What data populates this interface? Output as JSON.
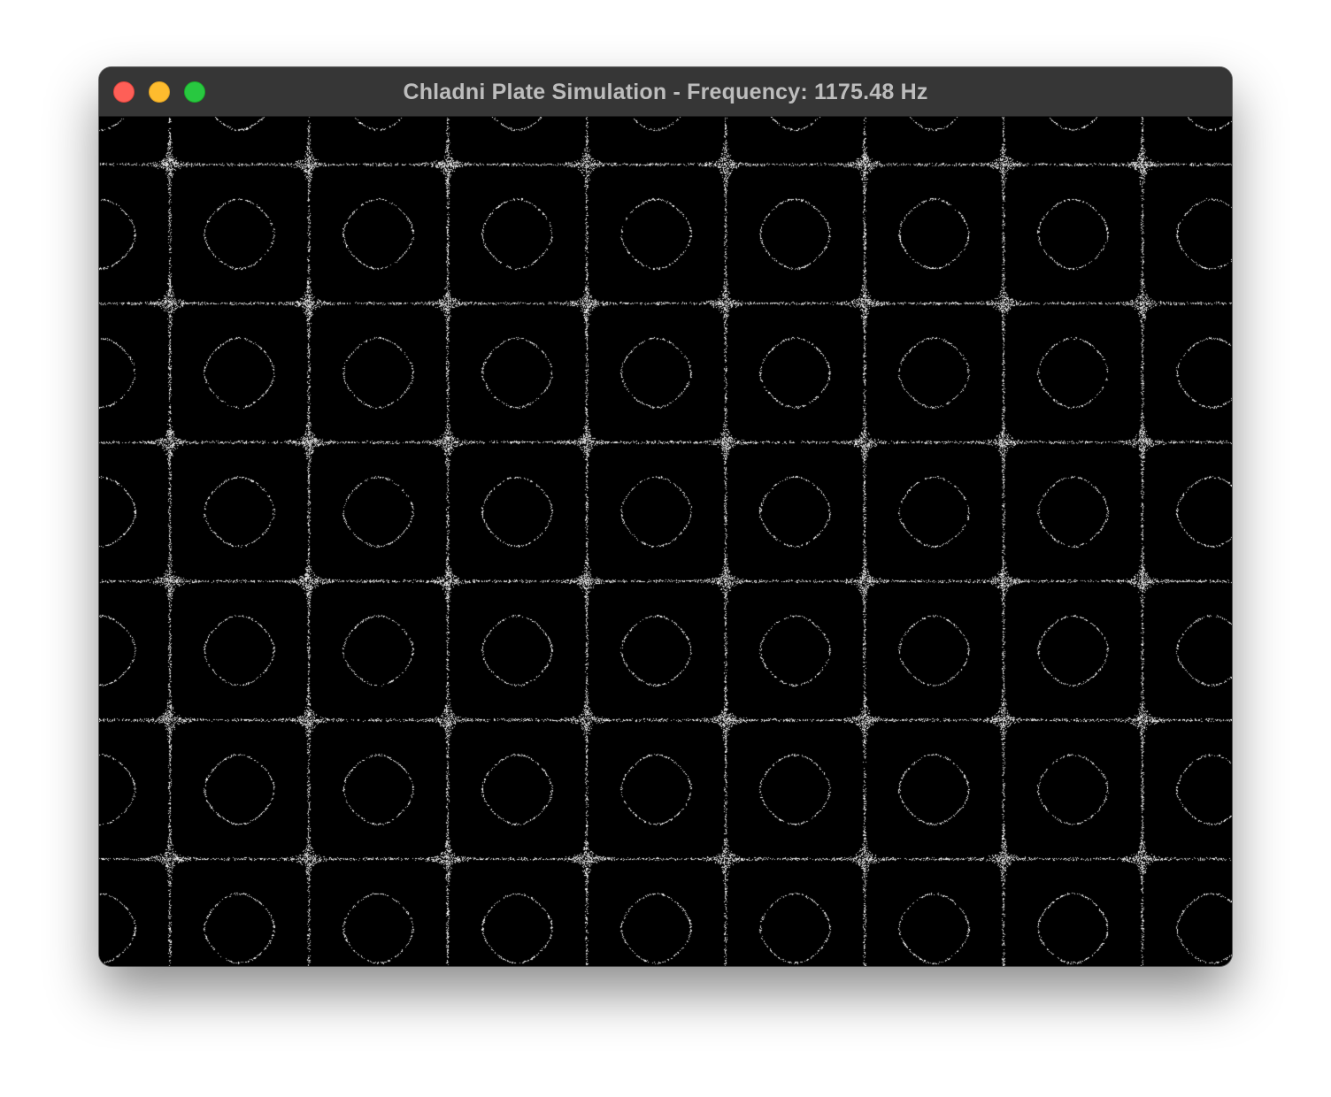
{
  "window": {
    "title": "Chladni Plate Simulation - Frequency: 1175.48 Hz",
    "controls": {
      "close_icon": "close-icon",
      "minimize_icon": "minimize-icon",
      "zoom_icon": "zoom-icon"
    }
  },
  "plate": {
    "background_color": "#000000",
    "particle_color": "#ffffff",
    "pattern": "sand particles settled on nodal lines"
  }
}
